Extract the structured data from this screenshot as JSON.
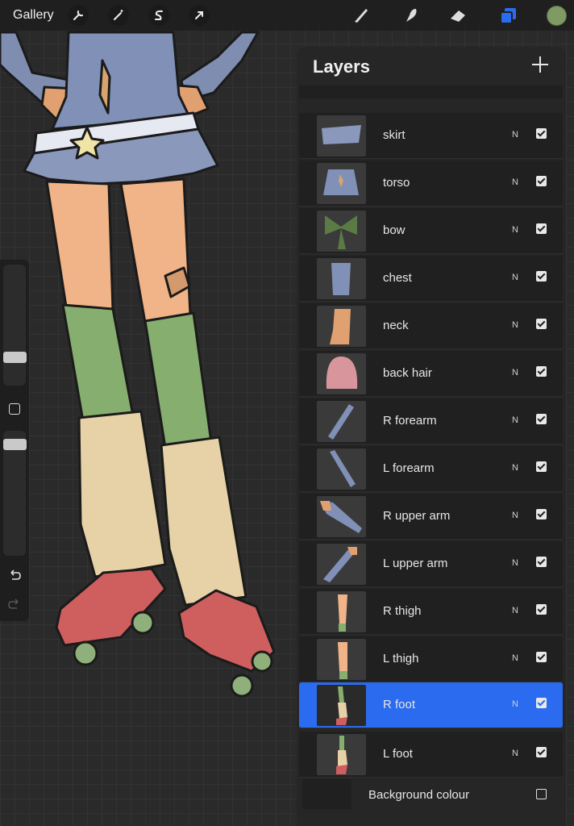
{
  "toolbar": {
    "gallery_label": "Gallery",
    "left_tools": [
      "wrench-icon",
      "magic-wand-icon",
      "selection-s-icon",
      "transform-arrow-icon"
    ],
    "right_tools": [
      "brush-icon",
      "smudge-icon",
      "eraser-icon",
      "layers-icon"
    ],
    "current_color": "#7f9a62"
  },
  "layers_panel": {
    "title": "Layers",
    "accent_color": "#2b6bf0",
    "layers": [
      {
        "name": "skirt",
        "blend": "N",
        "visible": true,
        "selected": false
      },
      {
        "name": "torso",
        "blend": "N",
        "visible": true,
        "selected": false
      },
      {
        "name": "bow",
        "blend": "N",
        "visible": true,
        "selected": false
      },
      {
        "name": "chest",
        "blend": "N",
        "visible": true,
        "selected": false
      },
      {
        "name": "neck",
        "blend": "N",
        "visible": true,
        "selected": false
      },
      {
        "name": "back hair",
        "blend": "N",
        "visible": true,
        "selected": false
      },
      {
        "name": "R forearm",
        "blend": "N",
        "visible": true,
        "selected": false
      },
      {
        "name": "L forearm",
        "blend": "N",
        "visible": true,
        "selected": false
      },
      {
        "name": "R upper arm",
        "blend": "N",
        "visible": true,
        "selected": false
      },
      {
        "name": "L upper arm",
        "blend": "N",
        "visible": true,
        "selected": false
      },
      {
        "name": "R thigh",
        "blend": "N",
        "visible": true,
        "selected": false
      },
      {
        "name": "L thigh",
        "blend": "N",
        "visible": true,
        "selected": false
      },
      {
        "name": "R foot",
        "blend": "N",
        "visible": true,
        "selected": true
      },
      {
        "name": "L foot",
        "blend": "N",
        "visible": true,
        "selected": false
      }
    ],
    "background_label": "Background colour"
  }
}
